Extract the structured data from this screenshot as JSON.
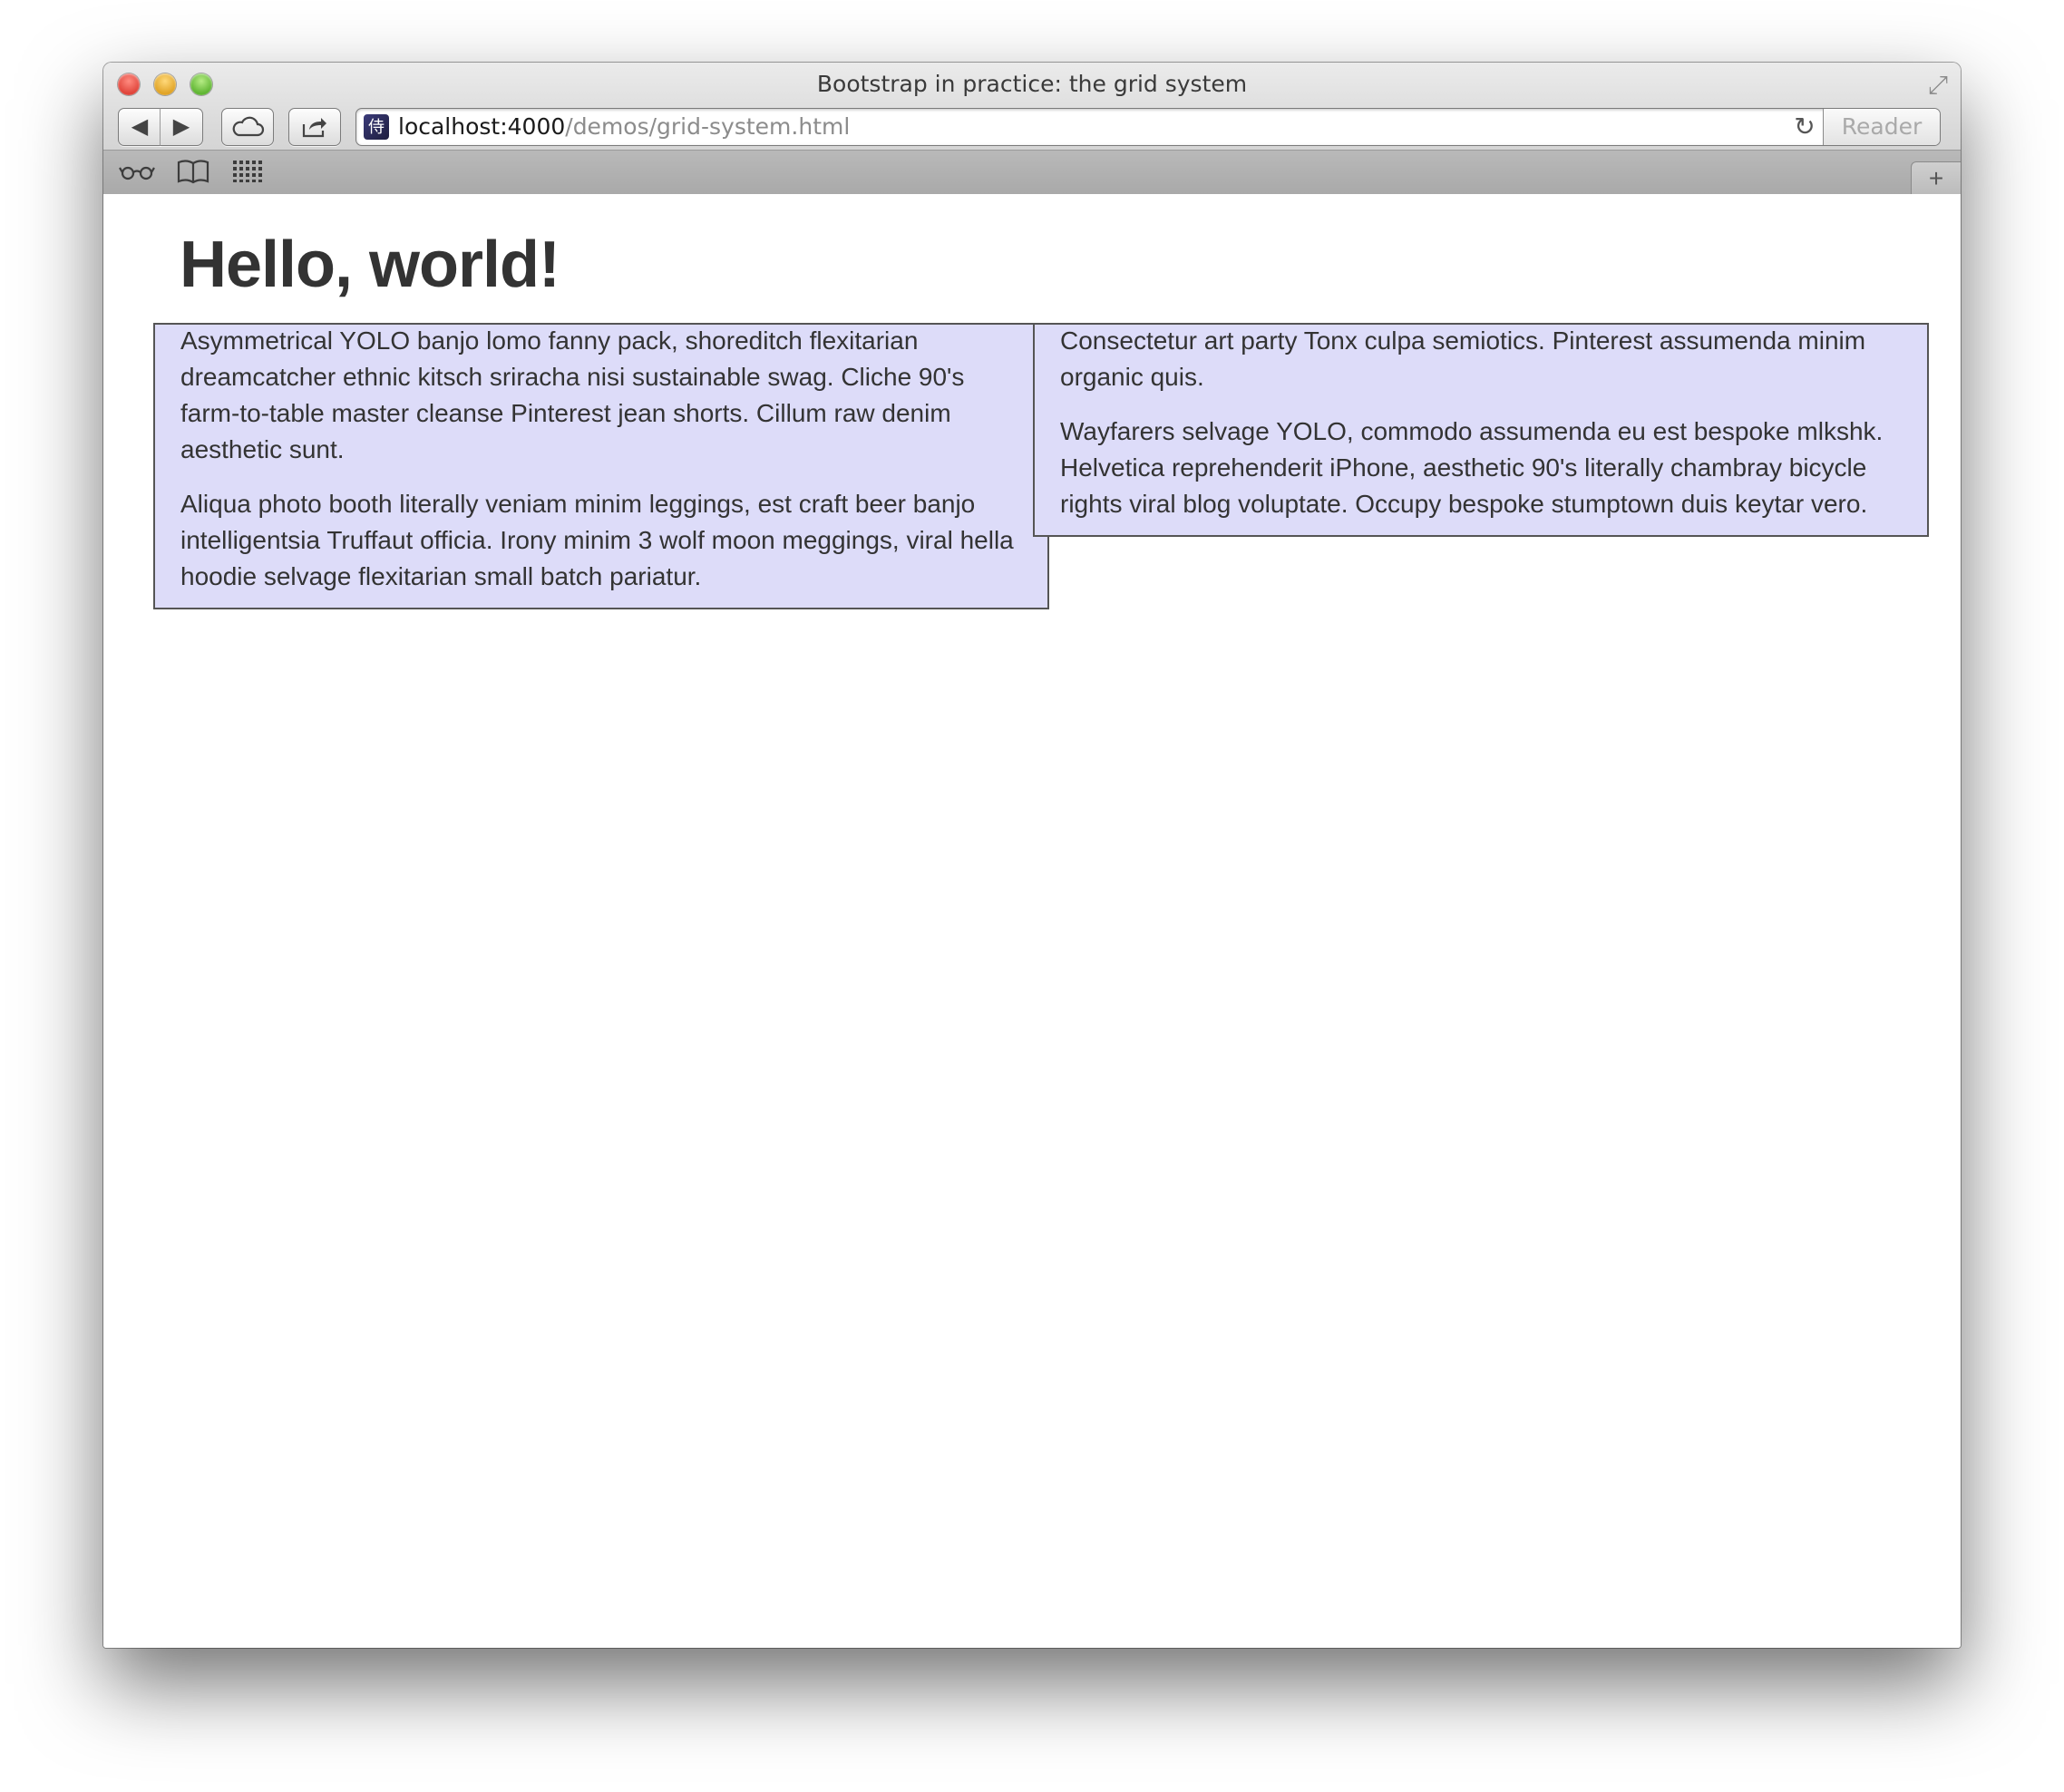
{
  "browser": {
    "window_title": "Bootstrap in practice: the grid system",
    "url_host": "localhost:4000",
    "url_path": "/demos/grid-system.html",
    "reader_label": "Reader",
    "icons": {
      "back": "back-arrow-icon",
      "forward": "forward-arrow-icon",
      "icloud": "cloud-icon",
      "share": "share-icon",
      "reload": "reload-icon",
      "reading_list": "glasses-icon",
      "bookmarks": "open-book-icon",
      "top_sites": "grid-icon",
      "new_tab": "plus-icon",
      "fullscreen": "fullscreen-arrows-icon"
    }
  },
  "page": {
    "heading": "Hello, world!",
    "columns": [
      {
        "paragraphs": [
          "Asymmetrical YOLO banjo lomo fanny pack, shoreditch flexitarian dreamcatcher ethnic kitsch sriracha nisi sustainable swag. Cliche 90's farm-to-table master cleanse Pinterest jean shorts. Cillum raw denim aesthetic sunt.",
          "Aliqua photo booth literally veniam minim leggings, est craft beer banjo intelligentsia Truffaut officia. Irony minim 3 wolf moon meggings, viral hella hoodie selvage flexitarian small batch pariatur."
        ]
      },
      {
        "paragraphs": [
          "Consectetur art party Tonx culpa semiotics. Pinterest assumenda minim organic quis.",
          "Wayfarers selvage YOLO, commodo assumenda eu est bespoke mlkshk. Helvetica reprehenderit iPhone, aesthetic 90's literally chambray bicycle rights viral blog voluptate. Occupy bespoke stumptown duis keytar vero."
        ]
      }
    ]
  },
  "colors": {
    "column_background": "#dddcf9",
    "column_border": "#555555",
    "text": "#333333"
  }
}
